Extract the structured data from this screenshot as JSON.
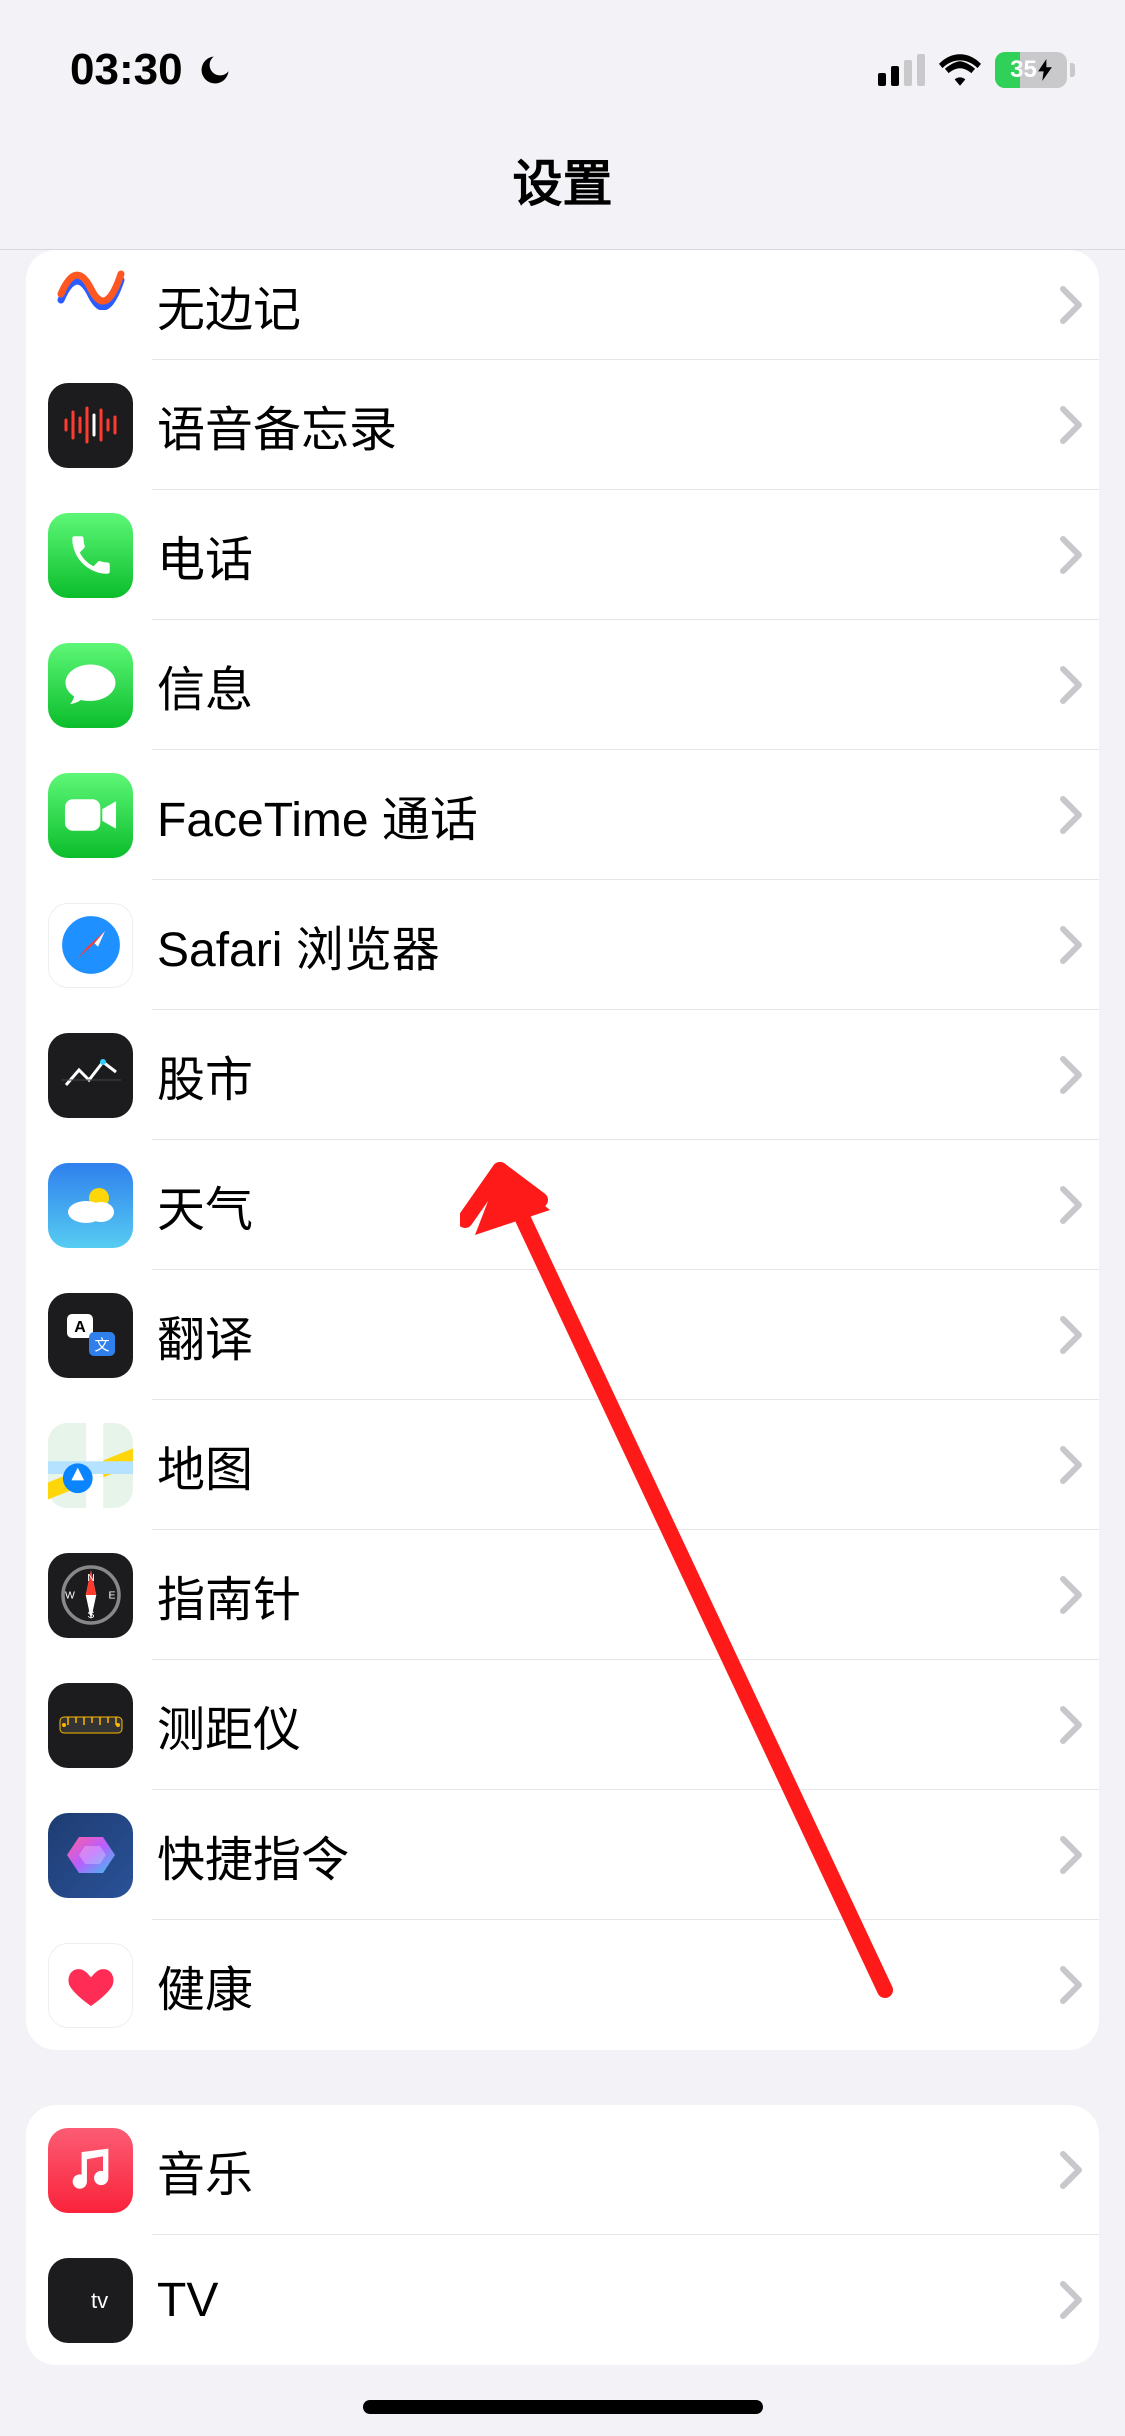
{
  "status": {
    "time": "03:30",
    "battery_percent": "35"
  },
  "nav": {
    "title": "设置"
  },
  "group1": {
    "items": [
      {
        "label": "无边记",
        "icon": "freeform"
      },
      {
        "label": "语音备忘录",
        "icon": "voice-memos"
      },
      {
        "label": "电话",
        "icon": "phone"
      },
      {
        "label": "信息",
        "icon": "messages"
      },
      {
        "label": "FaceTime 通话",
        "icon": "facetime"
      },
      {
        "label": "Safari 浏览器",
        "icon": "safari"
      },
      {
        "label": "股市",
        "icon": "stocks"
      },
      {
        "label": "天气",
        "icon": "weather"
      },
      {
        "label": "翻译",
        "icon": "translate"
      },
      {
        "label": "地图",
        "icon": "maps"
      },
      {
        "label": "指南针",
        "icon": "compass"
      },
      {
        "label": "测距仪",
        "icon": "measure"
      },
      {
        "label": "快捷指令",
        "icon": "shortcuts"
      },
      {
        "label": "健康",
        "icon": "health"
      }
    ]
  },
  "group2": {
    "items": [
      {
        "label": "音乐",
        "icon": "music"
      },
      {
        "label": "TV",
        "icon": "tv"
      }
    ]
  }
}
